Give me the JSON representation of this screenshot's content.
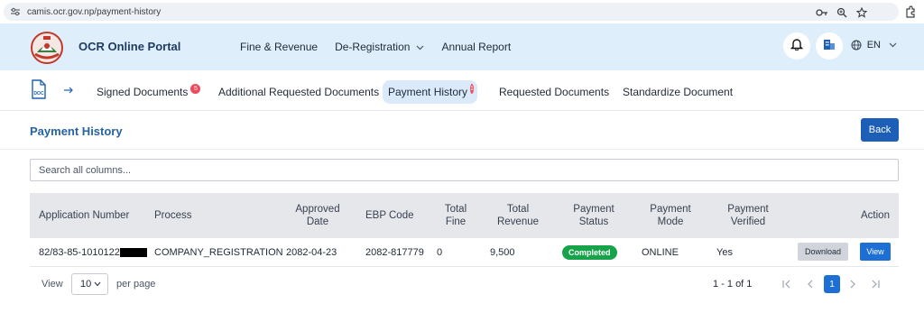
{
  "browser": {
    "url": "camis.ocr.gov.np/payment-history"
  },
  "header": {
    "title": "OCR Online Portal",
    "nav": [
      {
        "label": "Fine & Revenue"
      },
      {
        "label": "De-Registration"
      },
      {
        "label": "Annual Report"
      }
    ],
    "language": "EN"
  },
  "subnav": {
    "doc_icon_label": "DOC",
    "tabs": [
      {
        "label": "Signed Documents",
        "badge": "5"
      },
      {
        "label": "Additional Requested Documents"
      },
      {
        "label": "Payment History",
        "badge": "1"
      },
      {
        "label": "Requested Documents"
      },
      {
        "label": "Standardize Document"
      }
    ]
  },
  "page": {
    "title": "Payment History",
    "back_label": "Back",
    "search_placeholder": "Search all columns..."
  },
  "table": {
    "columns": [
      "Application Number",
      "Process",
      "Approved Date",
      "EBP Code",
      "Total Fine",
      "Total Revenue",
      "Payment Status",
      "Payment Mode",
      "Payment Verified",
      "Action"
    ],
    "rows": [
      {
        "application_number": "82/83-85-1010122",
        "process": "COMPANY_REGISTRATION",
        "approved_date": "2082-04-23",
        "ebp_code": "2082-817779",
        "total_fine": "0",
        "total_revenue": "9,500",
        "payment_status": "Completed",
        "payment_mode": "ONLINE",
        "payment_verified": "Yes",
        "download_label": "Download",
        "view_label": "View"
      }
    ]
  },
  "pagination": {
    "view_label": "View",
    "page_size": "10",
    "per_page_label": "per page",
    "range": "1 - 1 of 1",
    "current_page": "1"
  },
  "colors": {
    "header_bg": "#dfeefb",
    "primary": "#1d5fb8",
    "status_completed": "#16a34a",
    "badge": "#ef4a5e"
  }
}
